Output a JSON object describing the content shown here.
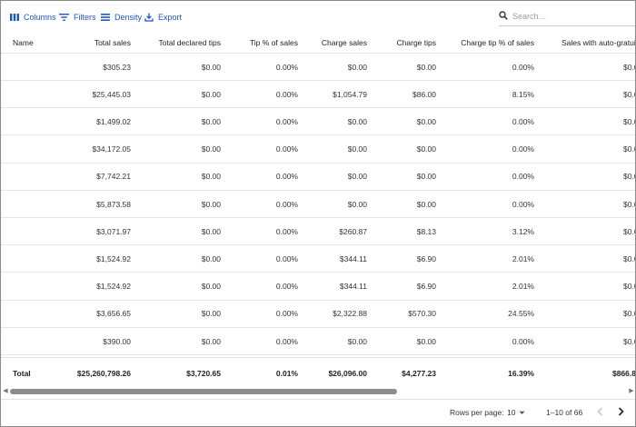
{
  "toolbar": {
    "columns_label": "Columns",
    "filters_label": "Filters",
    "density_label": "Density",
    "export_label": "Export",
    "search_placeholder": "Search…",
    "accent_color": "#1a56c4"
  },
  "table": {
    "headers": {
      "name": "Name",
      "total_sales": "Total sales",
      "total_declared_tips": "Total declared tips",
      "tip_pct_sales": "Tip % of sales",
      "charge_sales": "Charge sales",
      "charge_tips": "Charge tips",
      "charge_tip_pct_sales": "Charge tip % of sales",
      "sales_auto_gratuity": "Sales with auto-gratui"
    },
    "rows": [
      {
        "name": "",
        "total_sales": "$305.23",
        "total_declared_tips": "$0.00",
        "tip_pct_sales": "0.00%",
        "charge_sales": "$0.00",
        "charge_tips": "$0.00",
        "charge_tip_pct_sales": "0.00%",
        "sales_auto_gratuity": "$0.0"
      },
      {
        "name": "",
        "total_sales": "$25,445.03",
        "total_declared_tips": "$0.00",
        "tip_pct_sales": "0.00%",
        "charge_sales": "$1,054.79",
        "charge_tips": "$86.00",
        "charge_tip_pct_sales": "8.15%",
        "sales_auto_gratuity": "$0.0"
      },
      {
        "name": "",
        "total_sales": "$1,499.02",
        "total_declared_tips": "$0.00",
        "tip_pct_sales": "0.00%",
        "charge_sales": "$0.00",
        "charge_tips": "$0.00",
        "charge_tip_pct_sales": "0.00%",
        "sales_auto_gratuity": "$0.0"
      },
      {
        "name": "",
        "total_sales": "$34,172.05",
        "total_declared_tips": "$0.00",
        "tip_pct_sales": "0.00%",
        "charge_sales": "$0.00",
        "charge_tips": "$0.00",
        "charge_tip_pct_sales": "0.00%",
        "sales_auto_gratuity": "$0.0"
      },
      {
        "name": "",
        "total_sales": "$7,742.21",
        "total_declared_tips": "$0.00",
        "tip_pct_sales": "0.00%",
        "charge_sales": "$0.00",
        "charge_tips": "$0.00",
        "charge_tip_pct_sales": "0.00%",
        "sales_auto_gratuity": "$0.0"
      },
      {
        "name": "",
        "total_sales": "$5,873.58",
        "total_declared_tips": "$0.00",
        "tip_pct_sales": "0.00%",
        "charge_sales": "$0.00",
        "charge_tips": "$0.00",
        "charge_tip_pct_sales": "0.00%",
        "sales_auto_gratuity": "$0.0"
      },
      {
        "name": "",
        "total_sales": "$3,071.97",
        "total_declared_tips": "$0.00",
        "tip_pct_sales": "0.00%",
        "charge_sales": "$260.87",
        "charge_tips": "$8.13",
        "charge_tip_pct_sales": "3.12%",
        "sales_auto_gratuity": "$0.0"
      },
      {
        "name": "",
        "total_sales": "$1,524.92",
        "total_declared_tips": "$0.00",
        "tip_pct_sales": "0.00%",
        "charge_sales": "$344.11",
        "charge_tips": "$6.90",
        "charge_tip_pct_sales": "2.01%",
        "sales_auto_gratuity": "$0.0"
      },
      {
        "name": "",
        "total_sales": "$1,524.92",
        "total_declared_tips": "$0.00",
        "tip_pct_sales": "0.00%",
        "charge_sales": "$344.11",
        "charge_tips": "$6.90",
        "charge_tip_pct_sales": "2.01%",
        "sales_auto_gratuity": "$0.0"
      },
      {
        "name": "",
        "total_sales": "$3,656.65",
        "total_declared_tips": "$0.00",
        "tip_pct_sales": "0.00%",
        "charge_sales": "$2,322.88",
        "charge_tips": "$570.30",
        "charge_tip_pct_sales": "24.55%",
        "sales_auto_gratuity": "$0.0"
      },
      {
        "name": "",
        "total_sales": "$390.00",
        "total_declared_tips": "$0.00",
        "tip_pct_sales": "0.00%",
        "charge_sales": "$0.00",
        "charge_tips": "$0.00",
        "charge_tip_pct_sales": "0.00%",
        "sales_auto_gratuity": "$0.0"
      }
    ],
    "totals": {
      "name": "Total",
      "total_sales": "$25,260,798.26",
      "total_declared_tips": "$3,720.65",
      "tip_pct_sales": "0.01%",
      "charge_sales": "$26,096.00",
      "charge_tips": "$4,277.23",
      "charge_tip_pct_sales": "16.39%",
      "sales_auto_gratuity": "$866.8"
    }
  },
  "pagination": {
    "rows_per_page_label": "Rows per page:",
    "rows_per_page_value": "10",
    "range_label": "1–10 of 66"
  }
}
